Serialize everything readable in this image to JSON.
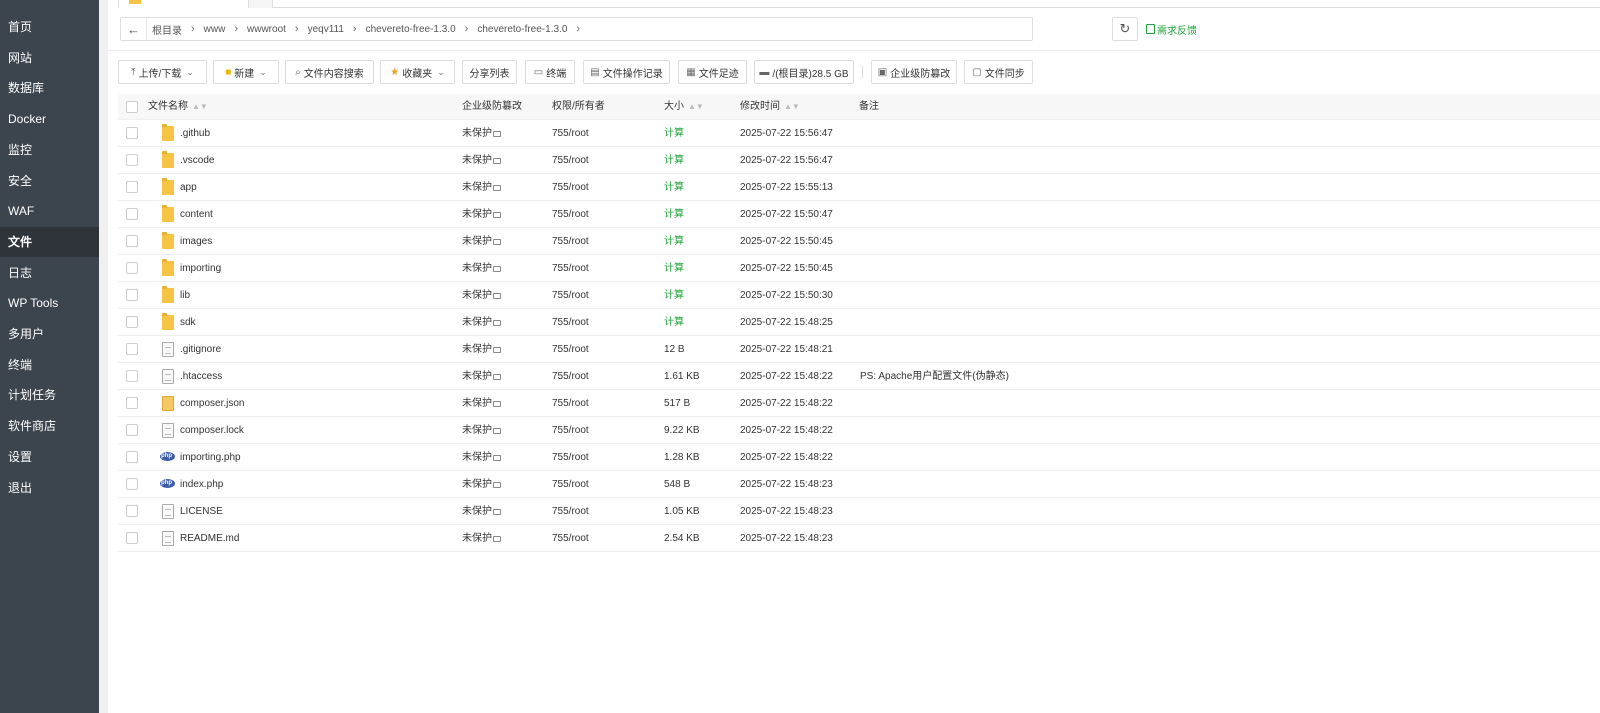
{
  "sidebar": {
    "items": [
      {
        "label": "首页"
      },
      {
        "label": "网站"
      },
      {
        "label": "数据库"
      },
      {
        "label": "Docker"
      },
      {
        "label": "监控"
      },
      {
        "label": "安全"
      },
      {
        "label": "WAF"
      },
      {
        "label": "文件",
        "active": true
      },
      {
        "label": "日志"
      },
      {
        "label": "WP Tools"
      },
      {
        "label": "多用户"
      },
      {
        "label": "终端"
      },
      {
        "label": "计划任务"
      },
      {
        "label": "软件商店"
      },
      {
        "label": "设置"
      },
      {
        "label": "退出"
      }
    ]
  },
  "breadcrumb": {
    "back_icon": "←",
    "items": [
      "根目录",
      "www",
      "wwwroot",
      "yeqv111",
      "chevereto-free-1.3.0",
      "chevereto-free-1.3.0"
    ],
    "separator": "›",
    "refresh_icon": "↻",
    "feedback_label": "需求反馈"
  },
  "toolbar": {
    "upload": "上传/下载",
    "new": "新建",
    "search_content": "文件内容搜索",
    "favorites": "收藏夹",
    "share_list": "分享列表",
    "terminal": "终端",
    "op_log": "文件操作记录",
    "footprint": "文件足迹",
    "disk": "/(根目录)28.5 GB",
    "tamper": "企业级防篡改",
    "sync": "文件同步"
  },
  "table": {
    "headers": {
      "name": "文件名称",
      "tamper": "企业级防篡改",
      "perm": "权限/所有者",
      "size": "大小",
      "mtime": "修改时间",
      "remark": "备注"
    },
    "rows": [
      {
        "name": ".github",
        "type": "folder",
        "tamper": "未保护",
        "perm": "755/root",
        "size": "计算",
        "mtime": "2025-07-22 15:56:47",
        "remark": ""
      },
      {
        "name": ".vscode",
        "type": "folder",
        "tamper": "未保护",
        "perm": "755/root",
        "size": "计算",
        "mtime": "2025-07-22 15:56:47",
        "remark": ""
      },
      {
        "name": "app",
        "type": "folder",
        "tamper": "未保护",
        "perm": "755/root",
        "size": "计算",
        "mtime": "2025-07-22 15:55:13",
        "remark": ""
      },
      {
        "name": "content",
        "type": "folder",
        "tamper": "未保护",
        "perm": "755/root",
        "size": "计算",
        "mtime": "2025-07-22 15:50:47",
        "remark": ""
      },
      {
        "name": "images",
        "type": "folder",
        "tamper": "未保护",
        "perm": "755/root",
        "size": "计算",
        "mtime": "2025-07-22 15:50:45",
        "remark": ""
      },
      {
        "name": "importing",
        "type": "folder",
        "tamper": "未保护",
        "perm": "755/root",
        "size": "计算",
        "mtime": "2025-07-22 15:50:45",
        "remark": ""
      },
      {
        "name": "lib",
        "type": "folder",
        "tamper": "未保护",
        "perm": "755/root",
        "size": "计算",
        "mtime": "2025-07-22 15:50:30",
        "remark": ""
      },
      {
        "name": "sdk",
        "type": "folder",
        "tamper": "未保护",
        "perm": "755/root",
        "size": "计算",
        "mtime": "2025-07-22 15:48:25",
        "remark": ""
      },
      {
        "name": ".gitignore",
        "type": "file",
        "tamper": "未保护",
        "perm": "755/root",
        "size": "12 B",
        "mtime": "2025-07-22 15:48:21",
        "remark": ""
      },
      {
        "name": ".htaccess",
        "type": "file",
        "tamper": "未保护",
        "perm": "755/root",
        "size": "1.61 KB",
        "mtime": "2025-07-22 15:48:22",
        "remark": "PS: Apache用户配置文件(伪静态)"
      },
      {
        "name": "composer.json",
        "type": "json",
        "tamper": "未保护",
        "perm": "755/root",
        "size": "517 B",
        "mtime": "2025-07-22 15:48:22",
        "remark": ""
      },
      {
        "name": "composer.lock",
        "type": "file",
        "tamper": "未保护",
        "perm": "755/root",
        "size": "9.22 KB",
        "mtime": "2025-07-22 15:48:22",
        "remark": ""
      },
      {
        "name": "importing.php",
        "type": "php",
        "tamper": "未保护",
        "perm": "755/root",
        "size": "1.28 KB",
        "mtime": "2025-07-22 15:48:22",
        "remark": ""
      },
      {
        "name": "index.php",
        "type": "php",
        "tamper": "未保护",
        "perm": "755/root",
        "size": "548 B",
        "mtime": "2025-07-22 15:48:23",
        "remark": ""
      },
      {
        "name": "LICENSE",
        "type": "file",
        "tamper": "未保护",
        "perm": "755/root",
        "size": "1.05 KB",
        "mtime": "2025-07-22 15:48:23",
        "remark": ""
      },
      {
        "name": "README.md",
        "type": "file",
        "tamper": "未保护",
        "perm": "755/root",
        "size": "2.54 KB",
        "mtime": "2025-07-22 15:48:23",
        "remark": ""
      }
    ]
  },
  "colors": {
    "sidebar_bg": "#3c444d",
    "sidebar_active": "#2e343a",
    "accent_green": "#20a53a",
    "folder_yellow": "#f6c444"
  }
}
